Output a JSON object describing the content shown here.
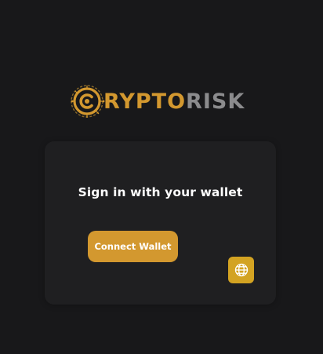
{
  "brand": {
    "name_part1": "RYPTO",
    "name_part2": "RISK",
    "accent_color": "#d3982f",
    "secondary_color": "#8b8b8d",
    "logo_icon": "crypto-c-circuit-icon"
  },
  "card": {
    "title": "Sign in with your wallet",
    "connect_button_label": "Connect Wallet",
    "language_button_icon": "globe-icon"
  },
  "colors": {
    "background": "#18181a",
    "card": "#1f1f21",
    "button": "#d3982f"
  }
}
